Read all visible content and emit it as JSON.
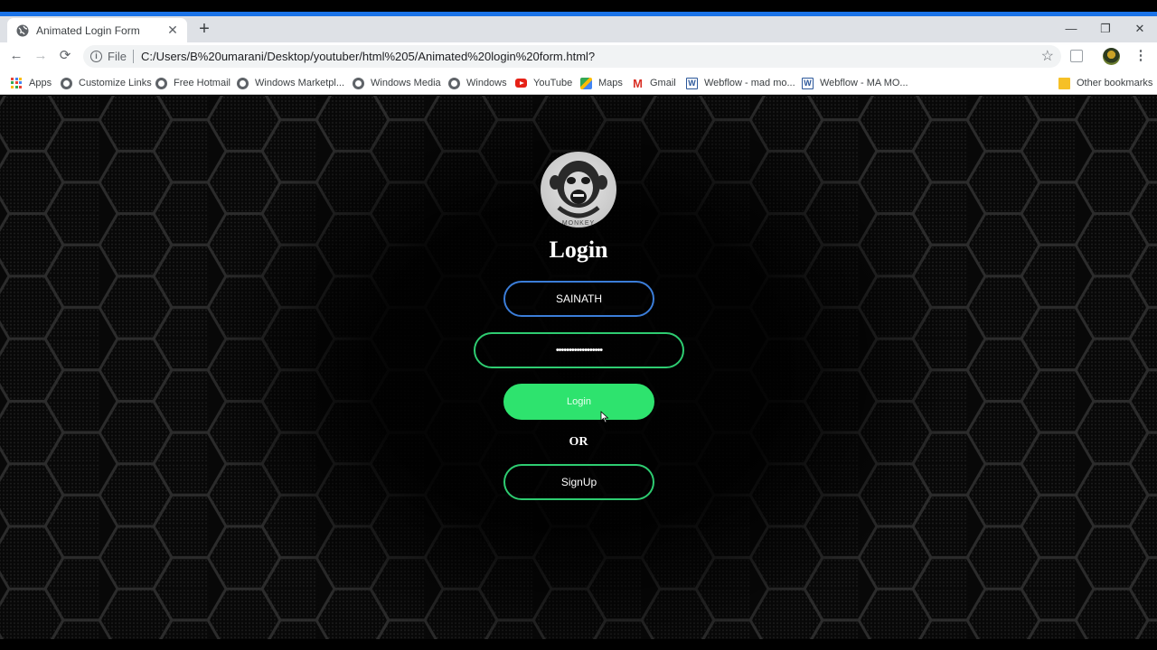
{
  "browser": {
    "tab_title": "Animated Login Form",
    "new_tab_symbol": "+",
    "close_tab_symbol": "✕",
    "window_controls": [
      "—",
      "❐",
      "✕"
    ],
    "nav": {
      "back": "←",
      "forward": "→",
      "reload": "⟳"
    },
    "address": {
      "scheme_label": "File",
      "url": "C:/Users/B%20umarani/Desktop/youtuber/html%205/Animated%20login%20form.html?"
    },
    "star_symbol": "☆",
    "menu_symbol": "⋮",
    "accent_color": "#1a73e8"
  },
  "bookmarks": [
    {
      "label": "Apps",
      "icon": "apps-grid-icon"
    },
    {
      "label": "Customize Links",
      "icon": "globe-icon"
    },
    {
      "label": "Free Hotmail",
      "icon": "globe-icon"
    },
    {
      "label": "Windows Marketpl...",
      "icon": "globe-icon"
    },
    {
      "label": "Windows Media",
      "icon": "globe-icon"
    },
    {
      "label": "Windows",
      "icon": "globe-icon"
    },
    {
      "label": "YouTube",
      "icon": "youtube-icon"
    },
    {
      "label": "Maps",
      "icon": "maps-icon"
    },
    {
      "label": "Gmail",
      "icon": "gmail-icon"
    },
    {
      "label": "Webflow - mad mo...",
      "icon": "word-icon"
    },
    {
      "label": "Webflow - MA MO...",
      "icon": "word-icon"
    },
    {
      "label": "Other bookmarks",
      "icon": "folder-icon"
    }
  ],
  "page": {
    "logo_icon": "monkey-logo-icon",
    "title": "Login",
    "username_value": "SAINATH",
    "password_value": "••••••••••••••••••",
    "login_label": "Login",
    "or_label": "OR",
    "signup_label": "SignUp",
    "colors": {
      "username_border": "#3b7dd8",
      "password_border": "#2ecc71",
      "login_bg": "#2ee36e",
      "signup_border": "#2ecc71"
    }
  }
}
